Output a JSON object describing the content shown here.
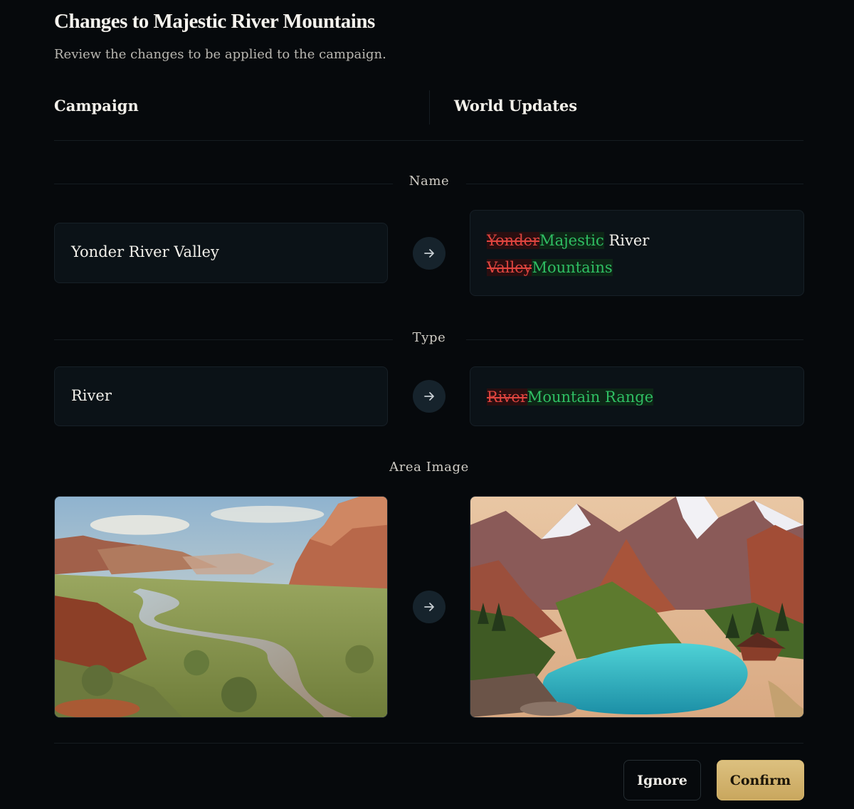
{
  "dialog": {
    "title": "Changes to Majestic River Mountains",
    "subtitle": "Review the changes to be applied to the campaign."
  },
  "columns": {
    "left": "Campaign",
    "right": "World Updates"
  },
  "sections": {
    "name": {
      "label": "Name",
      "campaign_value": "Yonder River Valley",
      "diff": [
        {
          "op": "del",
          "text": "Yonder"
        },
        {
          "op": "ins",
          "text": "Majestic"
        },
        {
          "op": "same",
          "text": " River "
        },
        {
          "op": "del",
          "text": "Valley"
        },
        {
          "op": "ins",
          "text": "Mountains"
        }
      ]
    },
    "type": {
      "label": "Type",
      "campaign_value": "River",
      "diff": [
        {
          "op": "del",
          "text": "River"
        },
        {
          "op": "ins",
          "text": "Mountain Range"
        }
      ]
    },
    "area_image": {
      "label": "Area Image"
    }
  },
  "icons": {
    "arrow": "arrow-right-icon"
  },
  "actions": {
    "ignore": "Ignore",
    "confirm": "Confirm"
  },
  "colors": {
    "background": "#06090c",
    "deleted": "#e0453f",
    "inserted": "#2fbf63",
    "confirm_accent": "#d4b46d"
  }
}
